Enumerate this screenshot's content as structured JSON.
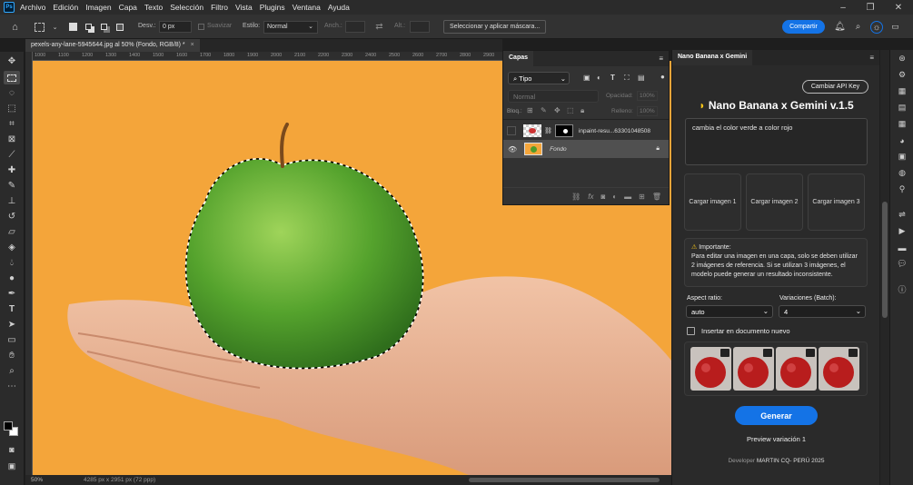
{
  "menubar": {
    "app_badge": "Ps",
    "items": [
      "Archivo",
      "Edición",
      "Imagen",
      "Capa",
      "Texto",
      "Selección",
      "Filtro",
      "Vista",
      "Plugins",
      "Ventana",
      "Ayuda"
    ]
  },
  "options": {
    "feather_label": "Desv.:",
    "feather_value": "0 px",
    "antialias_label": "Suavizar",
    "style_label": "Estilo:",
    "style_value": "Normal",
    "width_label": "Anch.:",
    "height_label": "Alt.:",
    "select_mask_button": "Seleccionar y aplicar máscara...",
    "share_button": "Compartir"
  },
  "document": {
    "tab_title": "pexels-any-lane-5945644.jpg al 50% (Fondo, RGB/8) *",
    "zoom": "50%",
    "dimensions": "4285 px x 2951 px (72 ppp)",
    "ruler_ticks": [
      "1000",
      "1100",
      "1200",
      "1300",
      "1400",
      "1500",
      "1600",
      "1700",
      "1800",
      "1900",
      "2000",
      "2100",
      "2200",
      "2300",
      "2400",
      "2500",
      "2600",
      "2700",
      "2800",
      "2900"
    ]
  },
  "layers": {
    "tab": "Capas",
    "kind_filter": "Tipo",
    "blend_mode": "Normal",
    "opacity_label": "Opacidad:",
    "opacity_value": "100%",
    "lock_label": "Bloq.:",
    "fill_label": "Relleno:",
    "fill_value": "100%",
    "items": [
      {
        "name": "inpaint-resu...63301048508",
        "visible": false
      },
      {
        "name": "Fondo",
        "visible": true,
        "selected": true
      }
    ]
  },
  "plugin": {
    "tab": "Nano Banana x Gemini",
    "change_key_button": "Cambiar API Key",
    "title": "Nano Banana x Gemini v.1.5",
    "prompt": "cambia el color verde a color rojo",
    "load_slots": [
      "Cargar imagen 1",
      "Cargar imagen 2",
      "Cargar imagen 3"
    ],
    "notice_title": "Importante:",
    "notice_text": "Para editar una imagen en una capa, solo se deben utilizar 2 imágenes de referencia. Si se utilizan 3 imágenes, el modelo puede generar un resultado inconsistente.",
    "aspect_label": "Aspect ratio:",
    "aspect_value": "auto",
    "variations_label": "Variaciones (Batch):",
    "variations_value": "4",
    "insert_new_doc_label": "Insertar en documento nuevo",
    "generate_button": "Generar",
    "preview_label": "Preview variación 1",
    "footer_prefix": "Developer",
    "footer_credit": "MARTIN CQ- PERÚ 2025"
  },
  "colors": {
    "accent": "#1473e6",
    "canvas_bg": "#f4a53a",
    "panel_bg": "#2a2a2a"
  }
}
